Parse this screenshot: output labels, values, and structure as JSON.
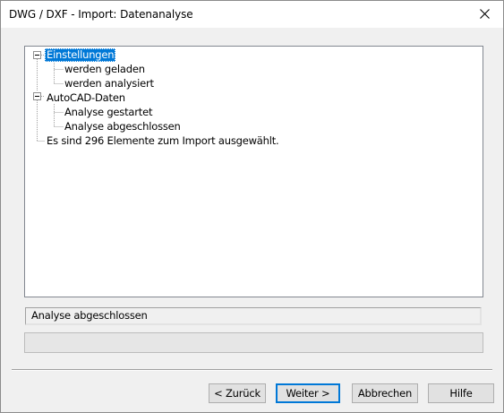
{
  "window": {
    "title": "DWG / DXF - Import: Datenanalyse"
  },
  "tree": {
    "items": [
      {
        "label": "Einstellungen"
      },
      {
        "label": "werden geladen"
      },
      {
        "label": "werden analysiert"
      },
      {
        "label": "AutoCAD-Daten"
      },
      {
        "label": "Analyse gestartet"
      },
      {
        "label": "Analyse abgeschlossen"
      },
      {
        "label": "Es sind 296 Elemente zum Import ausgewählt."
      }
    ]
  },
  "status": {
    "text": "Analyse abgeschlossen"
  },
  "progress": {
    "value": 0
  },
  "buttons": {
    "back": "< Zurück",
    "next": "Weiter >",
    "cancel": "Abbrechen",
    "help": "Hilfe"
  }
}
